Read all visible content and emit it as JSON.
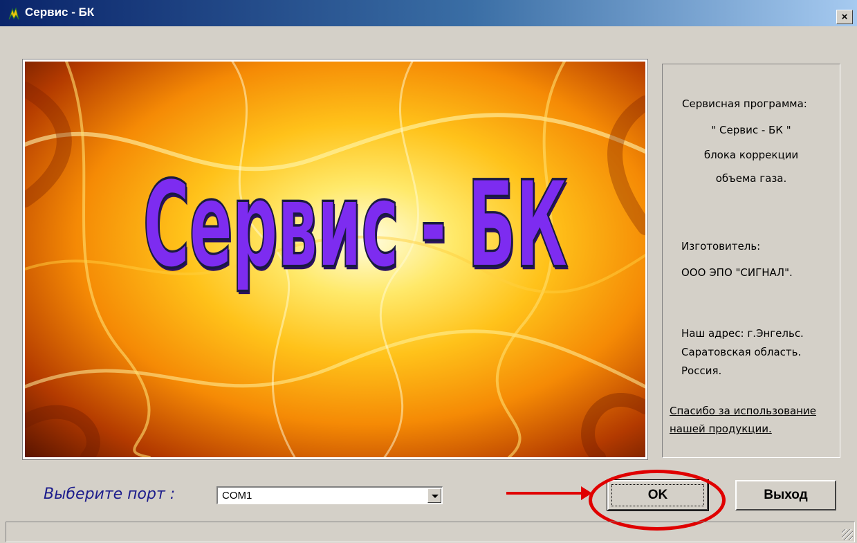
{
  "window": {
    "title": "Сервис - БК",
    "close_label": "×"
  },
  "splash": {
    "banner": "Сервис  -  БК"
  },
  "info": {
    "program_label": "Сервисная программа:",
    "program_name": "\" Сервис - БК \"",
    "program_desc_1": "блока коррекции",
    "program_desc_2": "объема газа.",
    "maker_label": "Изготовитель:",
    "maker_name": "ООО ЭПО \"СИГНАЛ\".",
    "address_1": "Наш адрес:  г.Энгельс.",
    "address_2": "Саратовская область.",
    "address_3": "Россия.",
    "thanks_1": "Спасибо за использование",
    "thanks_2": "нашей продукции."
  },
  "port": {
    "label": "Выберите порт :",
    "selected": "COM1"
  },
  "buttons": {
    "ok": "OK",
    "exit": "Выход"
  },
  "annotation": {
    "color": "#e00000"
  }
}
